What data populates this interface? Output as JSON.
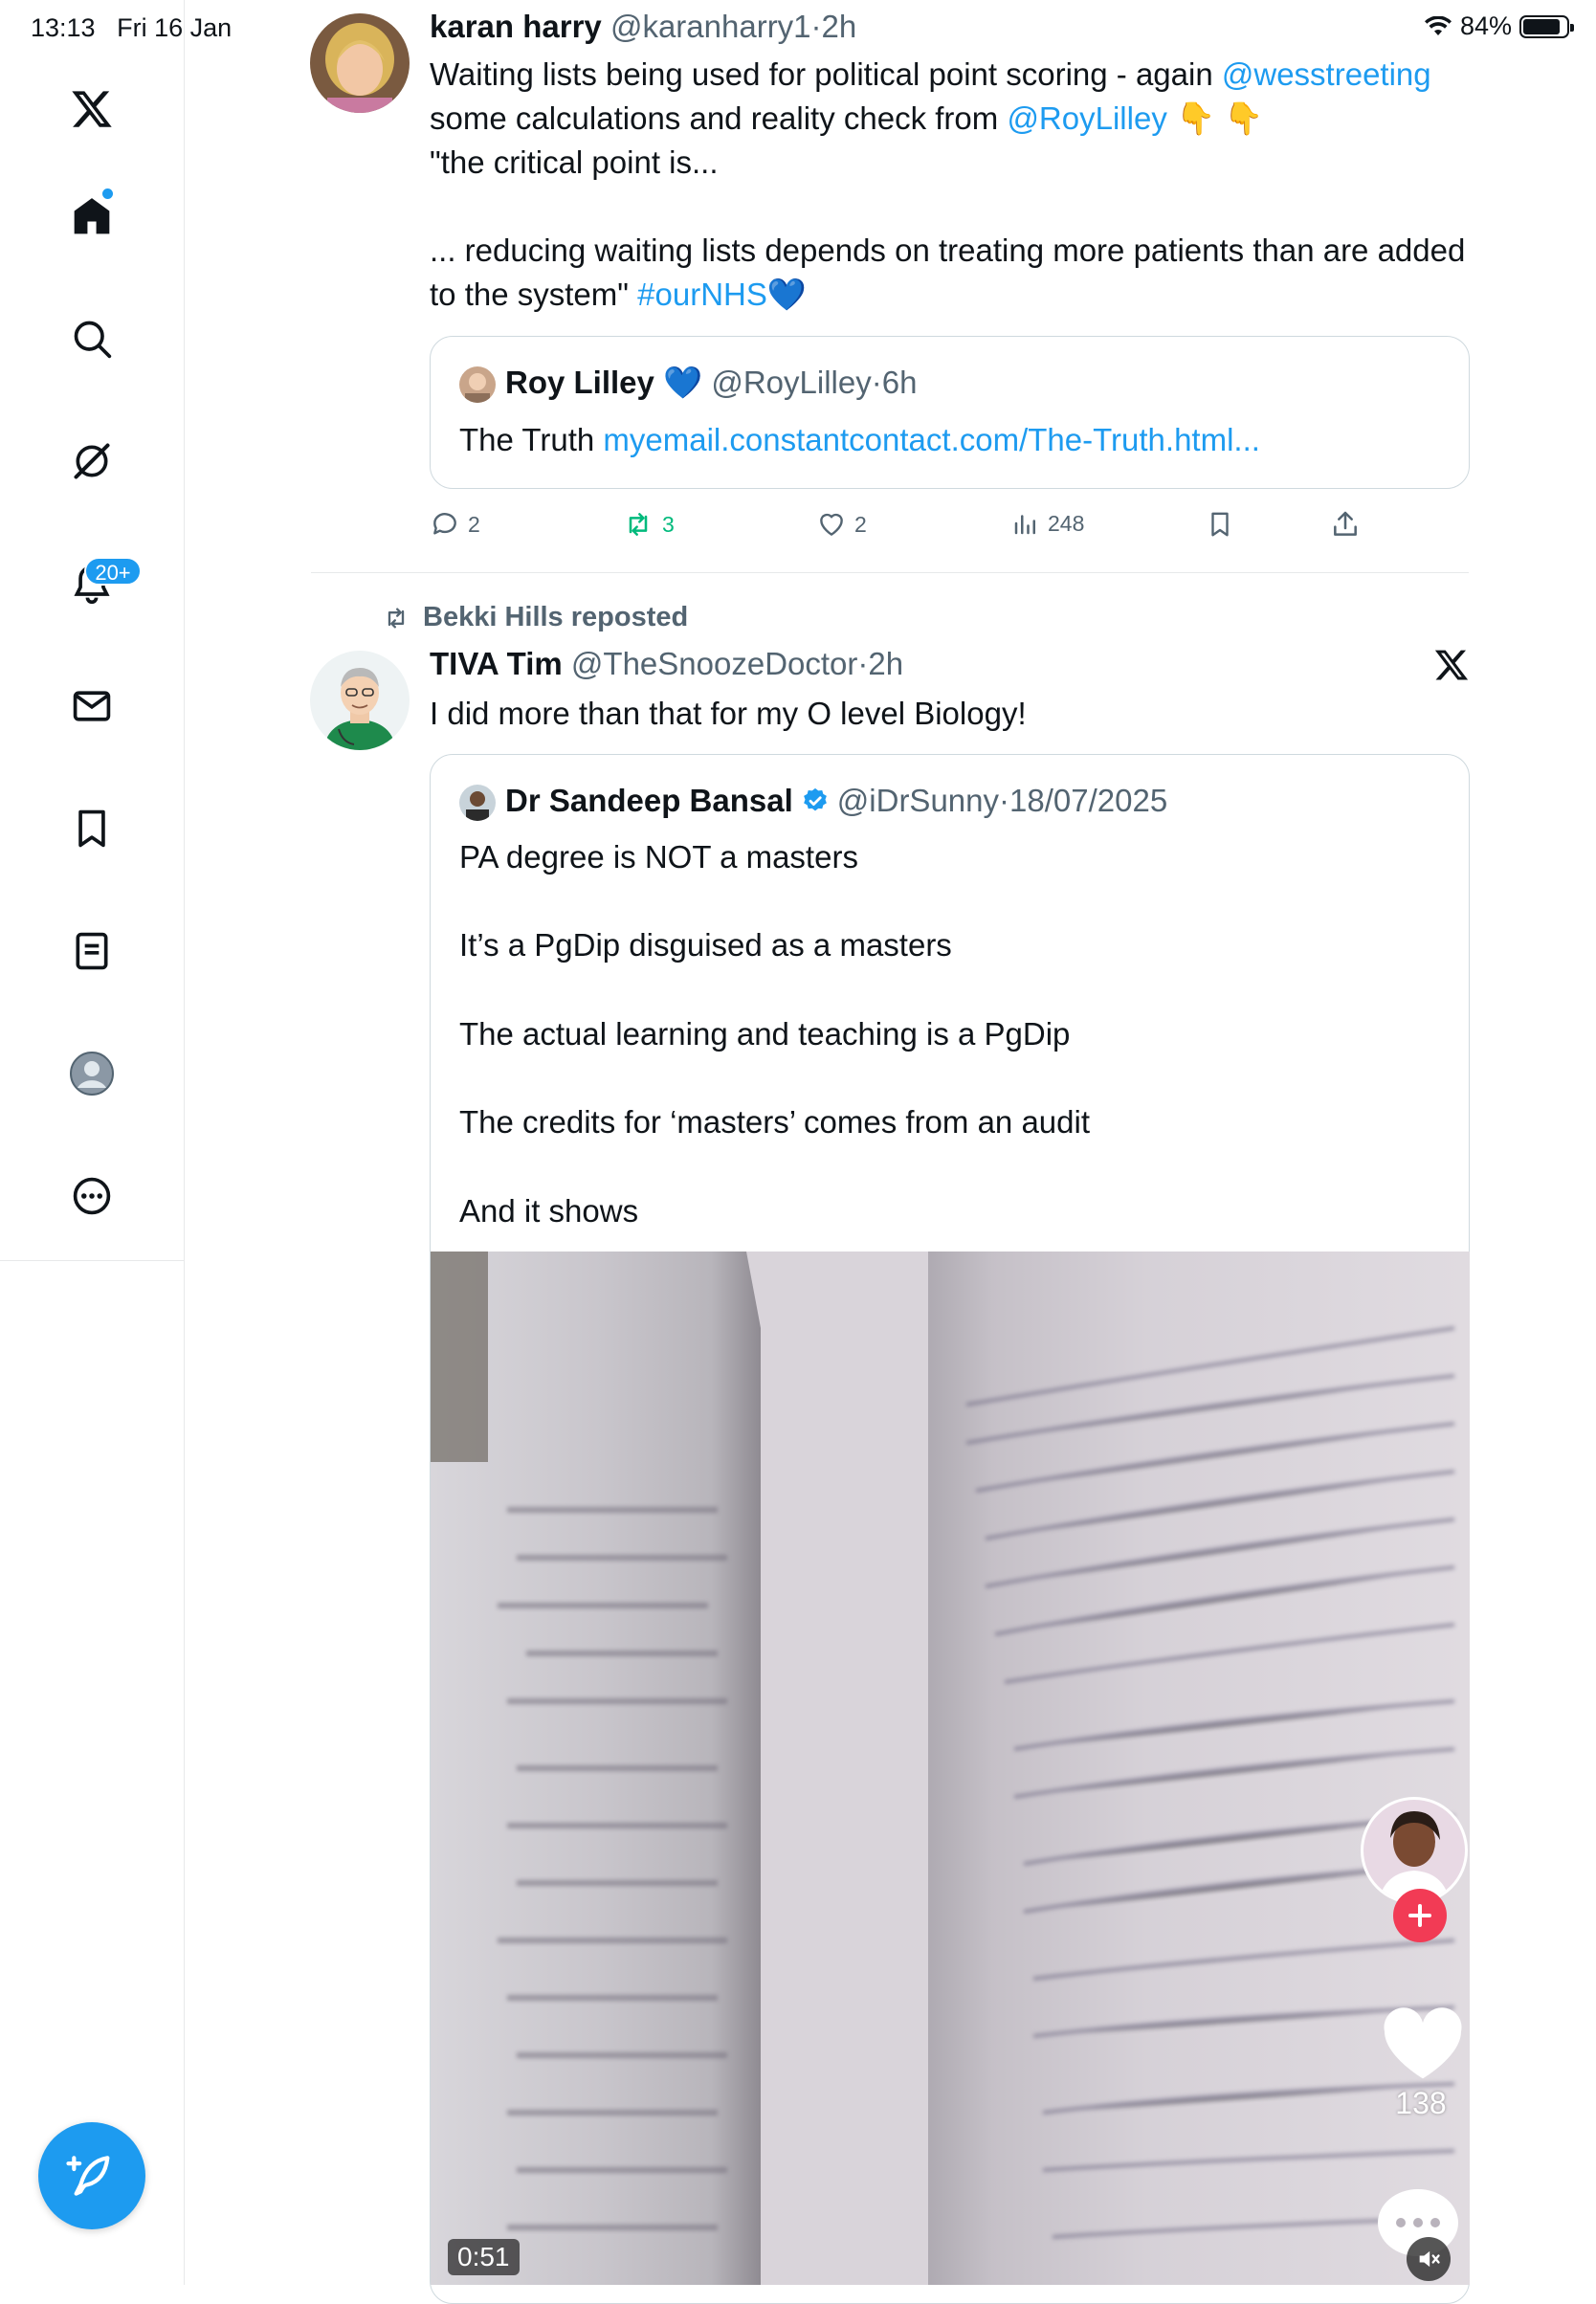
{
  "status_bar": {
    "time": "13:13",
    "date": "Fri 16 Jan",
    "battery": "84%"
  },
  "sidebar": {
    "items": [
      {
        "name": "home"
      },
      {
        "name": "search"
      },
      {
        "name": "grok"
      },
      {
        "name": "notifications",
        "badge": "20+"
      },
      {
        "name": "messages"
      },
      {
        "name": "bookmarks"
      },
      {
        "name": "lists"
      },
      {
        "name": "profile"
      },
      {
        "name": "more"
      }
    ]
  },
  "tweet1": {
    "name": "karan harry",
    "handle": "@karanharry1",
    "time": "2h",
    "text_part1": "Waiting lists being used for political point scoring - again ",
    "mention1": "@wesstreeting",
    "text_part2": "some calculations and reality check from ",
    "mention2": "@RoyLilley",
    "emoji": "👇 👇",
    "text_part3": "\"the critical point is...\n\n... reducing waiting lists depends on treating more patients than are added to the system\" ",
    "hashtag": "#ourNHS",
    "heart": "💙",
    "quote": {
      "name": "Roy Lilley",
      "name_emoji": "💙",
      "handle": "@RoyLilley",
      "time": "6h",
      "text": "The Truth ",
      "link": "myemail.constantcontact.com/The-Truth.html..."
    },
    "actions": {
      "replies": "2",
      "reposts": "3",
      "likes": "2",
      "views": "248"
    }
  },
  "tweet2": {
    "reposted_by": "Bekki Hills reposted",
    "name": "TIVA Tim",
    "handle": "@TheSnoozeDoctor",
    "time": "2h",
    "text": "I did more than that for my O level Biology!",
    "quote": {
      "name": "Dr Sandeep Bansal",
      "handle": "@iDrSunny",
      "time": "18/07/2025",
      "text": "PA degree is NOT a masters\n\nIt’s a PgDip disguised as a masters\n\nThe actual learning and teaching is a PgDip\n\nThe credits for ‘masters’ comes from an audit\n\nAnd it shows"
    },
    "video": {
      "duration": "0:51",
      "like_count": "138"
    }
  },
  "colors": {
    "accent": "#1d9bf0",
    "repost_green": "#00ba7c",
    "text": "#0f1419",
    "muted": "#536471"
  }
}
